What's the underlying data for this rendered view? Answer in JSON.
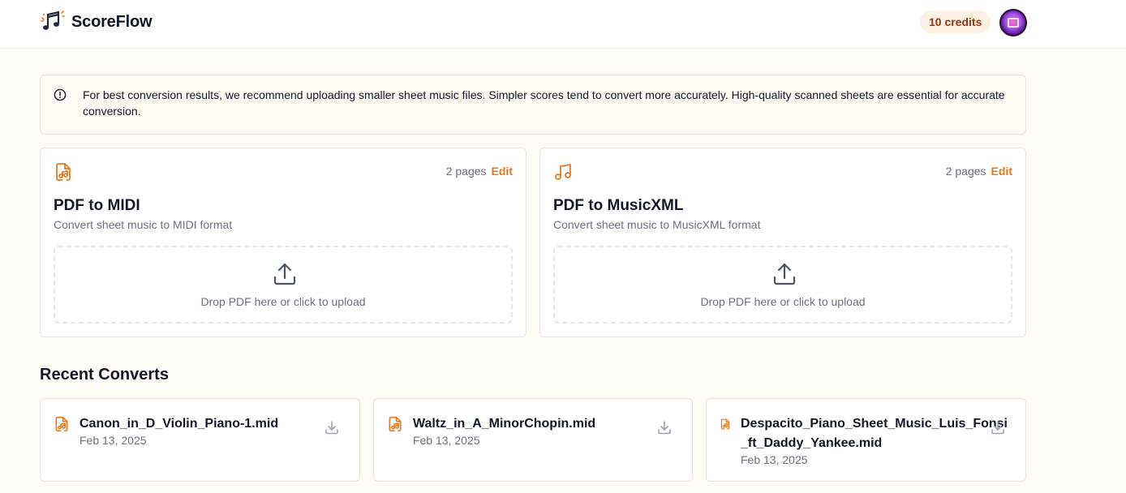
{
  "header": {
    "app_name": "ScoreFlow",
    "credits_label": "10 credits"
  },
  "notice": {
    "text": "For best conversion results, we recommend uploading smaller sheet music files. Simpler scores tend to convert more accurately. High-quality scanned sheets are essential for accurate conversion."
  },
  "converters": [
    {
      "icon": "file-music-icon",
      "pages": "2 pages",
      "edit": "Edit",
      "title": "PDF to MIDI",
      "description": "Convert sheet music to MIDI format",
      "upload_text": "Drop PDF here or click to upload"
    },
    {
      "icon": "music-notes-icon",
      "pages": "2 pages",
      "edit": "Edit",
      "title": "PDF to MusicXML",
      "description": "Convert sheet music to MusicXML format",
      "upload_text": "Drop PDF here or click to upload"
    }
  ],
  "recent": {
    "title": "Recent Converts",
    "items": [
      {
        "name": "Canon_in_D_Violin_Piano-1.mid",
        "date": "Feb 13, 2025"
      },
      {
        "name": "Waltz_in_A_MinorChopin.mid",
        "date": "Feb 13, 2025"
      },
      {
        "name_line1": "Despacito_Piano_Sheet_Music_Luis_Fonsi",
        "name_line2": "_ft_Daddy_Yankee.mid",
        "date": "Feb 13, 2025"
      }
    ]
  },
  "colors": {
    "accent": "#ea7a1c",
    "background": "#fffbf6",
    "credits_bg": "#fdf1e4",
    "credits_text": "#9a3412"
  }
}
